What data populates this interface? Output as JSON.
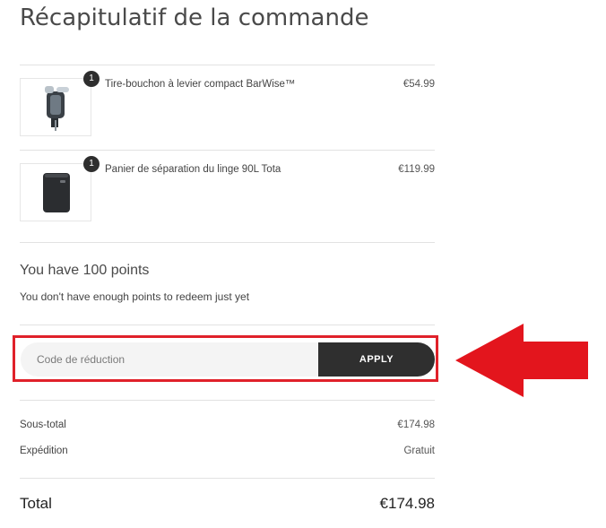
{
  "summary": {
    "title": "Récapitulatif de la commande"
  },
  "items": [
    {
      "name": "Tire-bouchon à levier compact BarWise™",
      "price": "€54.99",
      "quantity": "1",
      "image": "corkscrew-product-image"
    },
    {
      "name": "Panier de séparation du linge 90L Tota",
      "price": "€119.99",
      "quantity": "1",
      "image": "laundry-basket-product-image"
    }
  ],
  "points": {
    "title": "You have 100 points",
    "message": "You don't have enough points to redeem just yet"
  },
  "discount": {
    "placeholder": "Code de réduction",
    "value": "",
    "apply_label": "APPLY"
  },
  "totals": {
    "subtotal_label": "Sous-total",
    "subtotal_value": "€174.98",
    "shipping_label": "Expédition",
    "shipping_value": "Gratuit",
    "total_label": "Total",
    "total_value": "€174.98"
  },
  "colors": {
    "highlight_red": "#e0212a",
    "button_dark": "#2f2f2f",
    "input_bg": "#f4f4f4"
  }
}
